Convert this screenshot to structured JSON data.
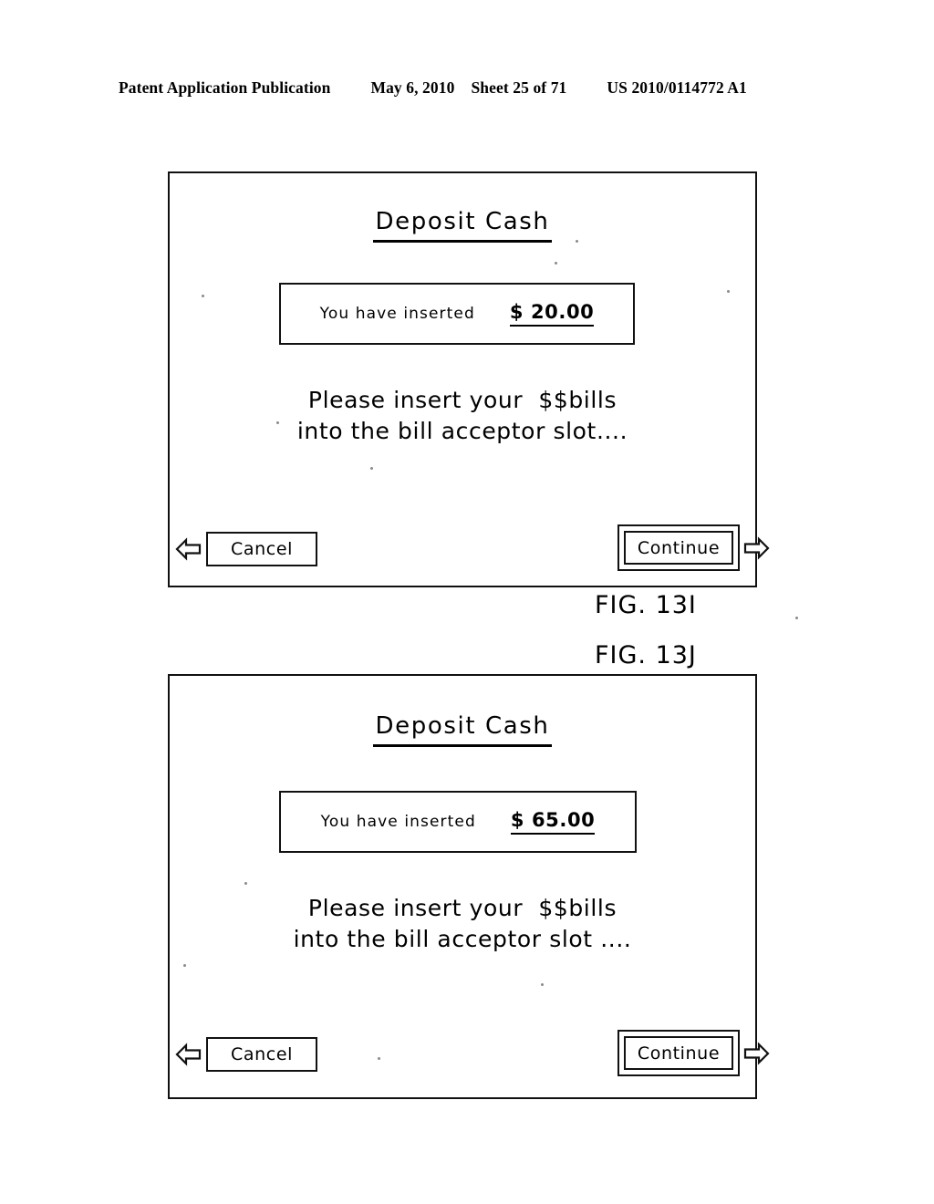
{
  "header": {
    "publication": "Patent Application Publication",
    "date": "May 6, 2010",
    "sheet": "Sheet 25 of 71",
    "number": "US 2010/0114772 A1"
  },
  "figures": [
    {
      "caption": "FIG. 13I",
      "screen": {
        "title": "Deposit Cash",
        "amount_label": "You have inserted",
        "amount_value": "$ 20.00",
        "instruction_line1": "Please insert your  $$bills",
        "instruction_line2": "into the bill acceptor slot....",
        "cancel_label": "Cancel",
        "continue_label": "Continue",
        "back_arrow_icon": "left-arrow-icon",
        "forward_arrow_icon": "right-arrow-icon"
      }
    },
    {
      "caption": "FIG. 13J",
      "screen": {
        "title": "Deposit Cash",
        "amount_label": "You have inserted",
        "amount_value": "$ 65.00",
        "instruction_line1": "Please insert your  $$bills",
        "instruction_line2": "into the bill acceptor slot ....",
        "cancel_label": "Cancel",
        "continue_label": "Continue",
        "back_arrow_icon": "left-arrow-icon",
        "forward_arrow_icon": "right-arrow-icon"
      }
    }
  ],
  "colors": {
    "ink": "#000000",
    "paper": "#ffffff"
  }
}
